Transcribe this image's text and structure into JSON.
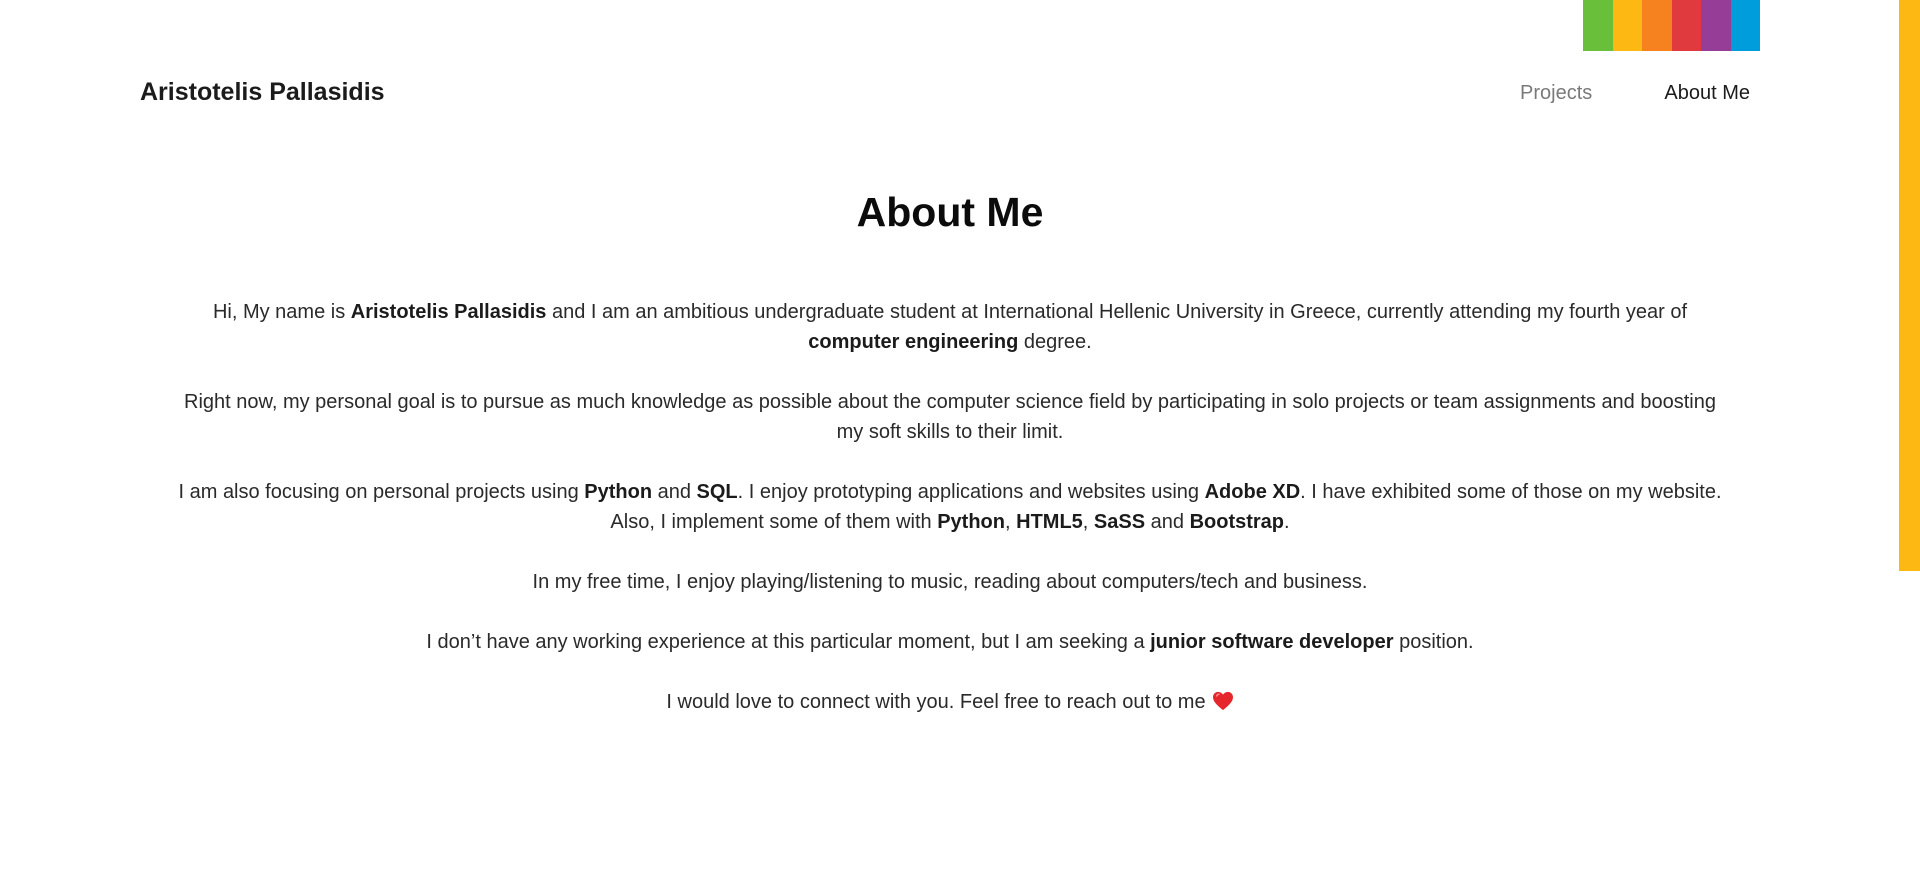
{
  "header": {
    "brand": "Aristotelis Pallasidis",
    "nav": [
      {
        "label": "Projects"
      },
      {
        "label": "About Me"
      }
    ]
  },
  "decor": {
    "strip_colors": [
      "#6abf3a",
      "#fdb813",
      "#f5821f",
      "#e03a3e",
      "#963d97",
      "#009ddc"
    ],
    "accent_color": "#fdb813"
  },
  "main": {
    "title": "About Me",
    "p1": {
      "t1": "Hi, My name is ",
      "b1": "Aristotelis Pallasidis",
      "t2": " and I am an ambitious undergraduate student at International Hellenic University in Greece, currently attending my fourth year of ",
      "b2": "computer engineering",
      "t3": " degree."
    },
    "p2": {
      "t1": "Right now, my personal goal is to pursue as much knowledge as possible about the computer science field by participating in solo projects or team assignments and boosting my soft skills to their limit."
    },
    "p3": {
      "t1": "I am also focusing on personal projects using ",
      "b1": "Python",
      "t2": " and ",
      "b2": "SQL",
      "t3": ". I enjoy prototyping applications and websites using ",
      "b3": "Adobe XD",
      "t4": ". I have exhibited some of those on my website. Also, I implement some of them with ",
      "b4": "Python",
      "t5": ", ",
      "b5": "HTML5",
      "t6": ", ",
      "b6": "SaSS",
      "t7": " and ",
      "b7": "Bootstrap",
      "t8": "."
    },
    "p4": {
      "t1": "In my free time, I enjoy playing/listening to music, reading about computers/tech and business."
    },
    "p5": {
      "t1": "I don’t have any working experience at this particular moment, but I am seeking a ",
      "b1": "junior software developer",
      "t2": " position."
    },
    "p6": {
      "t1": "I would love to connect with you. Feel free to reach out to me",
      "icon": "heart-icon"
    }
  }
}
